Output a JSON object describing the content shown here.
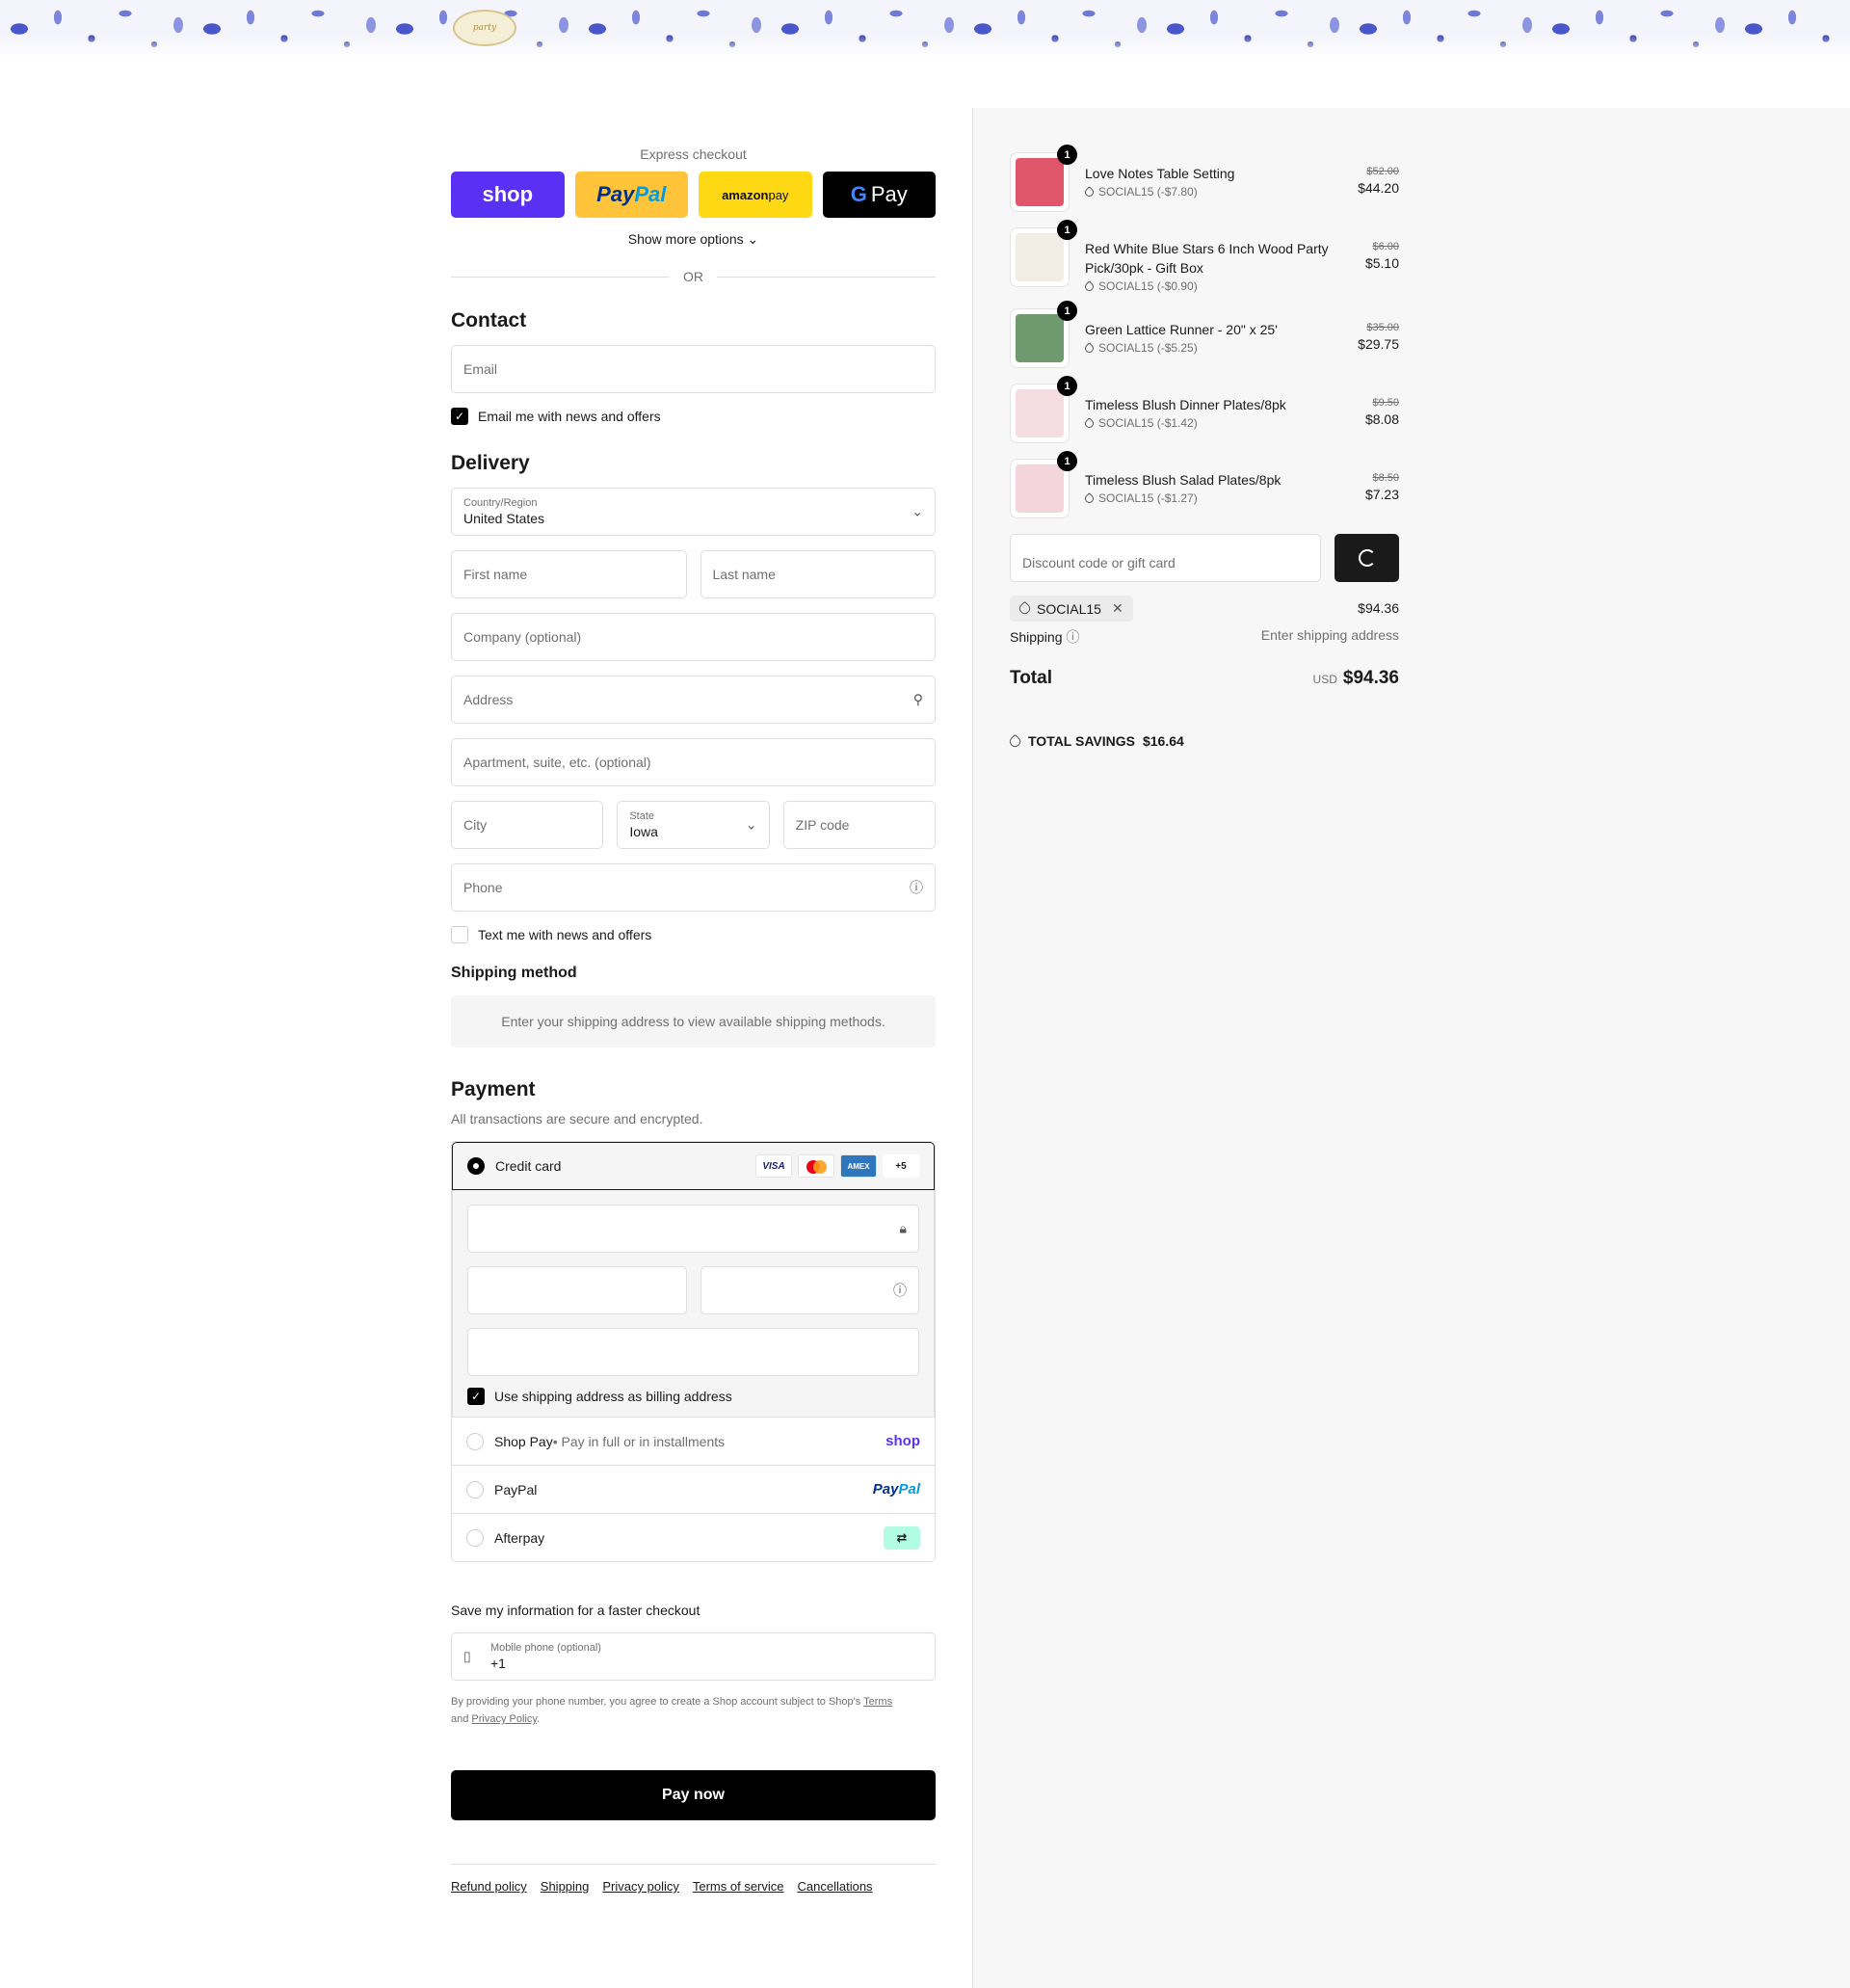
{
  "header": {
    "logo_text": "party"
  },
  "express": {
    "title": "Express checkout",
    "shop_label": "shop",
    "paypal_a": "Pay",
    "paypal_b": "Pal",
    "amazon_a": "amazon",
    "amazon_b": " pay",
    "gpay_g": "G",
    "gpay_label": "Pay",
    "more_label": "Show more options ⌄",
    "or_label": "OR"
  },
  "contact": {
    "heading": "Contact",
    "email_placeholder": "Email",
    "news_label": "Email me with news and offers"
  },
  "delivery": {
    "heading": "Delivery",
    "country_label": "Country/Region",
    "country_value": "United States",
    "first_name": "First name",
    "last_name": "Last name",
    "company": "Company (optional)",
    "address": "Address",
    "apartment": "Apartment, suite, etc. (optional)",
    "city": "City",
    "state_label": "State",
    "state_value": "Iowa",
    "zip": "ZIP code",
    "phone": "Phone",
    "text_label": "Text me with news and offers"
  },
  "shipping": {
    "heading": "Shipping method",
    "message": "Enter your shipping address to view available shipping methods."
  },
  "payment": {
    "heading": "Payment",
    "subtitle": "All transactions are secure and encrypted.",
    "credit_card": "Credit card",
    "visa": "VISA",
    "amex": "AMEX",
    "more_cards": "+5",
    "billing_label": "Use shipping address as billing address",
    "shoppay_label": "Shop Pay",
    "shoppay_sub": " • Pay in full or in installments",
    "shoppay_logo": "shop",
    "paypal_label": "PayPal",
    "paypal_logo_a": "Pay",
    "paypal_logo_b": "Pal",
    "afterpay_label": "Afterpay",
    "afterpay_logo": "⇄"
  },
  "save": {
    "title": "Save my information for a faster checkout",
    "phone_label": "Mobile phone (optional)",
    "phone_value": "+1",
    "legal_a": "By providing your phone number, you agree to create a Shop account subject to Shop's ",
    "terms": "Terms",
    "legal_b": "and ",
    "privacy": "Privacy Policy",
    "legal_c": "."
  },
  "pay_now": "Pay now",
  "footer_links": [
    "Refund policy",
    "Shipping",
    "Privacy policy",
    "Terms of service",
    "Cancellations"
  ],
  "items": [
    {
      "name": "Love Notes Table Setting",
      "discount": "SOCIAL15 (-$7.80)",
      "old": "$52.00",
      "price": "$44.20",
      "qty": "1",
      "color": "#e0566a"
    },
    {
      "name": "Red White Blue Stars 6 Inch Wood Party Pick/30pk - Gift Box",
      "discount": "SOCIAL15 (-$0.90)",
      "old": "$6.00",
      "price": "$5.10",
      "qty": "1",
      "color": "#f1ede4"
    },
    {
      "name": "Green Lattice Runner - 20\" x 25'",
      "discount": "SOCIAL15 (-$5.25)",
      "old": "$35.00",
      "price": "$29.75",
      "qty": "1",
      "color": "#6f9a6f"
    },
    {
      "name": "Timeless Blush Dinner Plates/8pk",
      "discount": "SOCIAL15 (-$1.42)",
      "old": "$9.50",
      "price": "$8.08",
      "qty": "1",
      "color": "#f6dde2"
    },
    {
      "name": "Timeless Blush Salad Plates/8pk",
      "discount": "SOCIAL15 (-$1.27)",
      "old": "$8.50",
      "price": "$7.23",
      "qty": "1",
      "color": "#f3d6dc"
    }
  ],
  "summary": {
    "discount_placeholder": "Discount code or gift card",
    "code": "SOCIAL15",
    "subtotal": "$94.36",
    "shipping_label": "Shipping",
    "shipping_value": "Enter shipping address",
    "total_label": "Total",
    "currency": "USD",
    "total": "$94.36",
    "savings_label": "TOTAL SAVINGS",
    "savings_value": "$16.64"
  }
}
